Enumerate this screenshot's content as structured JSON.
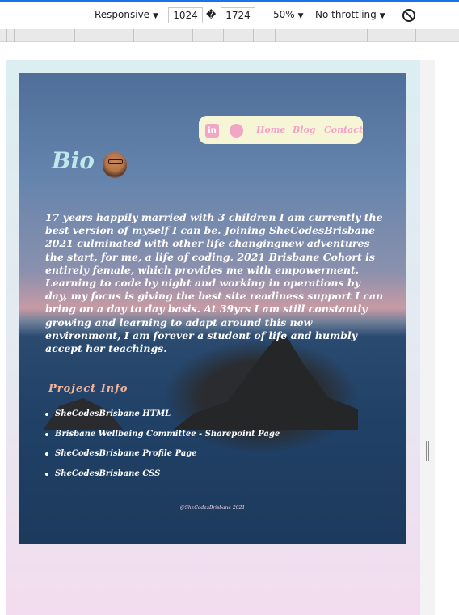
{
  "devtools": {
    "device_mode": "Responsive",
    "width": "1024",
    "swap_glyph": "�",
    "height": "1724",
    "zoom": "50%",
    "throttling": "No throttling",
    "caret": "▼"
  },
  "site": {
    "nav": {
      "linkedin_icon": "in",
      "github_icon": "●",
      "links": [
        "Home",
        "Blog",
        "Contact"
      ]
    },
    "bio_title": "Bio",
    "bio_text": "17 years happily married with 3 children I am currently the best version of myself I can be. Joining SheCodesBrisbane 2021 culminated with other life changingnew adventures the start, for me, a life of coding. 2021 Brisbane Cohort is entirely female, which provides me with empowerment. Learning to code by night and working in operations by day, my focus is giving the best site readiness support I can bring on a day to day basis. At 39yrs I am still constantly growing and learning to adapt around this new environment, I am forever a student of life and humbly accept her teachings.",
    "project_title": "Project Info",
    "projects": [
      "SheCodesBrisbane HTML",
      "Brisbane Wellbeing Committee - Sharepoint Page",
      "SheCodesBrisbane Profile Page",
      "SheCodesBrisbane CSS"
    ],
    "footer": "@SheCodesBrisbane 2021"
  },
  "colors": {
    "nav_bg": "#f6f5d6",
    "nav_link": "#f4a3c6",
    "bio_title": "#bfe8ec",
    "project_title": "#f2b49b"
  }
}
